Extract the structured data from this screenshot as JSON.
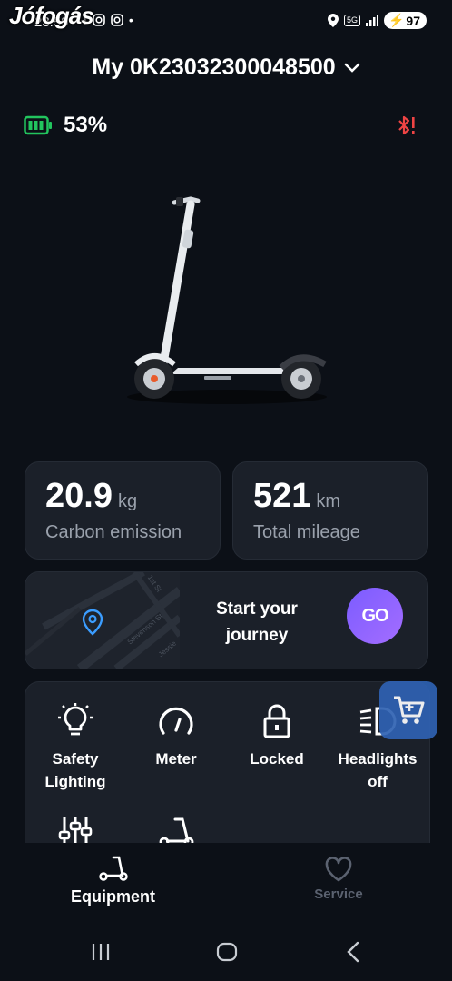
{
  "watermark": "Jófogás",
  "status": {
    "time": "23:59",
    "network": "5G",
    "battery": "97"
  },
  "device": {
    "title": "My 0K23032300048500"
  },
  "battery": {
    "percent": "53%"
  },
  "stats": [
    {
      "value": "20.9",
      "unit": "kg",
      "label": "Carbon emission"
    },
    {
      "value": "521",
      "unit": "km",
      "label": "Total mileage"
    }
  ],
  "journey": {
    "text_line1": "Start your",
    "text_line2": "journey",
    "go_label": "GO",
    "map_labels": [
      "1st St",
      "Stevenson St",
      "Jessie"
    ]
  },
  "features": [
    {
      "line1": "Safety",
      "line2": "Lighting",
      "icon": "bulb-icon"
    },
    {
      "line1": "Meter",
      "line2": "",
      "icon": "gauge-icon"
    },
    {
      "line1": "Locked",
      "line2": "",
      "icon": "lock-icon"
    },
    {
      "line1": "Headlights",
      "line2": "off",
      "icon": "headlight-icon"
    }
  ],
  "nav": {
    "equipment": "Equipment",
    "service": "Service"
  },
  "colors": {
    "accent": "#7b5cff",
    "battery_green": "#22c55e",
    "bt_warning": "#ef4444",
    "cart_blue": "#2f62b3"
  }
}
